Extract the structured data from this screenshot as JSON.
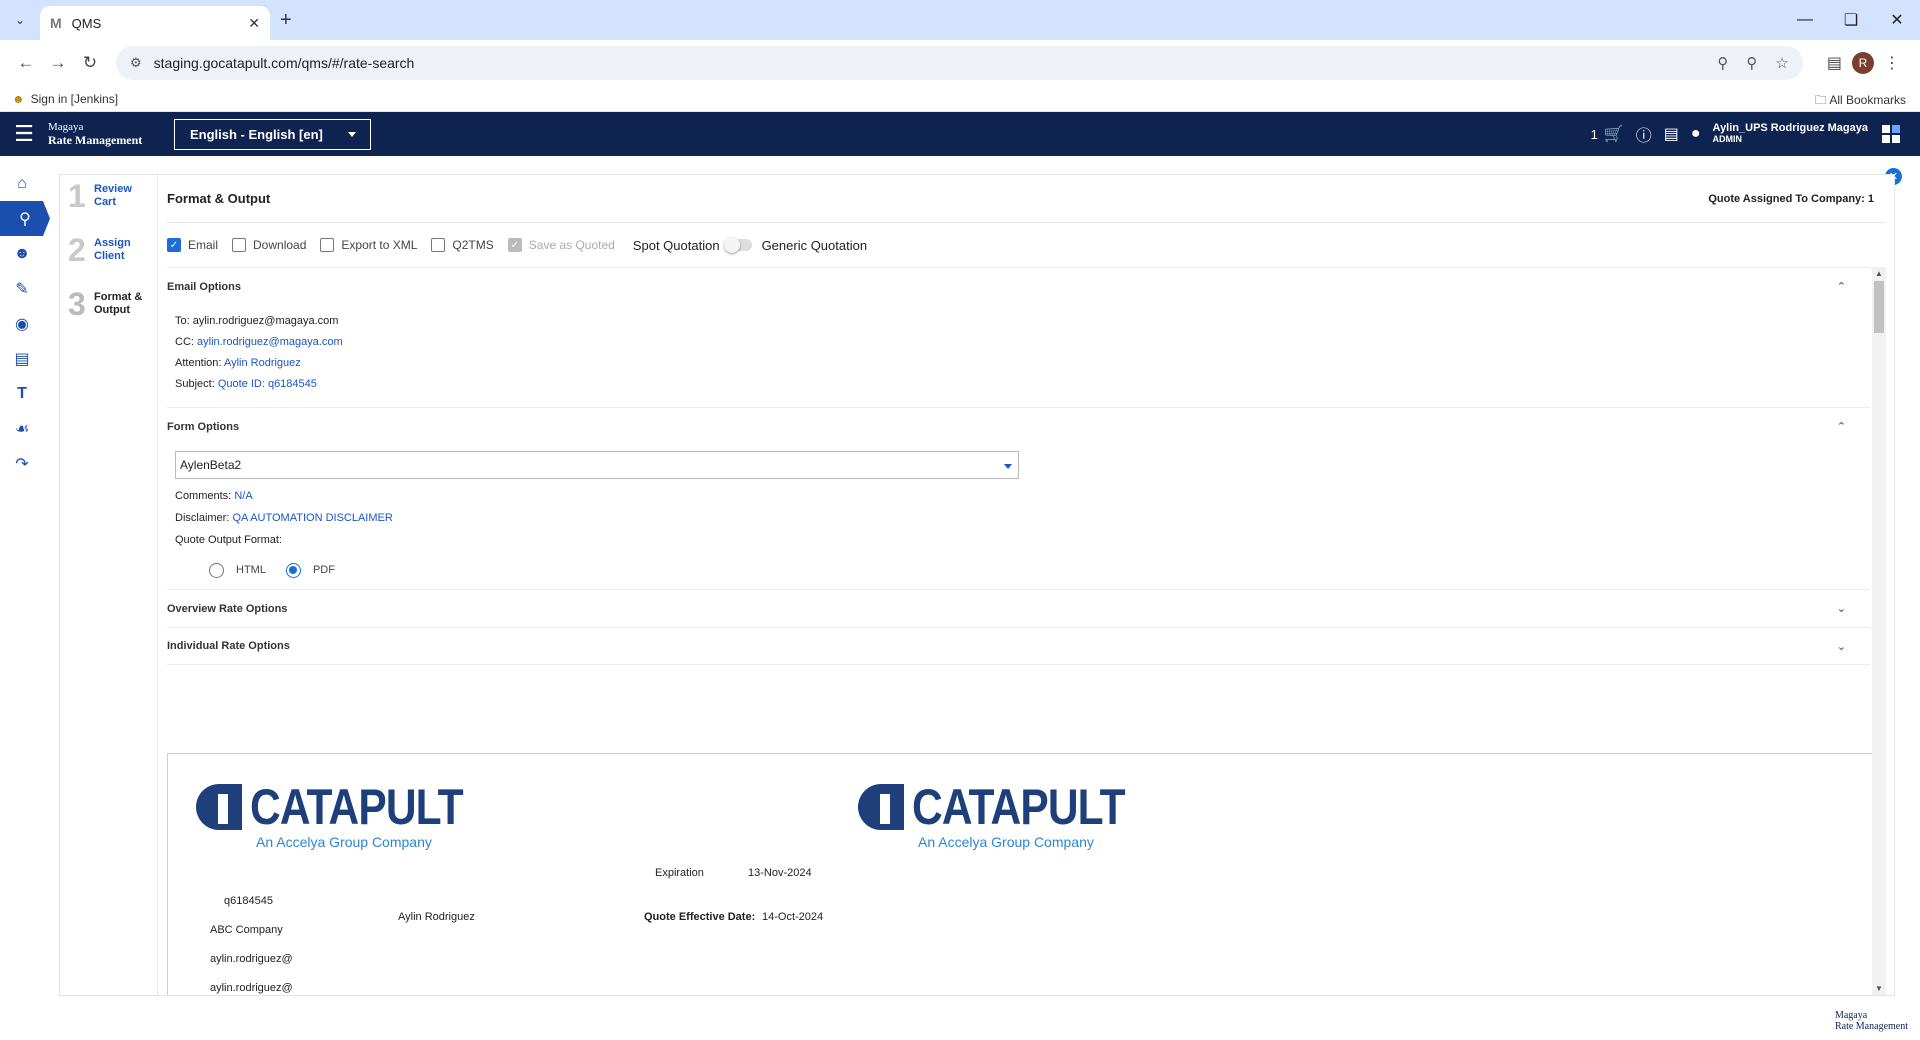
{
  "browser": {
    "tab_title": "QMS",
    "tab_favicon": "M",
    "url": "staging.gocatapult.com/qms/#/rate-search",
    "bookmark": "Sign in [Jenkins]",
    "all_bookmarks": "All Bookmarks",
    "profile_initial": "R"
  },
  "header": {
    "brand_line1": "Magaya",
    "brand_line2": "Rate Management",
    "language": "English - English [en]",
    "cart_count": "1",
    "user_name": "Aylin_UPS Rodriguez Magaya",
    "user_role": "ADMIN"
  },
  "steps": [
    {
      "num": "1",
      "label_1": "Review",
      "label_2": "Cart"
    },
    {
      "num": "2",
      "label_1": "Assign",
      "label_2": "Client"
    },
    {
      "num": "3",
      "label_1": "Format &",
      "label_2": "Output"
    }
  ],
  "content": {
    "title": "Format & Output",
    "quote_assigned": "Quote Assigned To Company: 1",
    "options": {
      "email": "Email",
      "download": "Download",
      "export_xml": "Export to XML",
      "q2tms": "Q2TMS",
      "save_as_quoted": "Save as Quoted",
      "spot": "Spot Quotation",
      "generic": "Generic Quotation"
    },
    "email_options": {
      "heading": "Email Options",
      "to_label": "To:",
      "to_value": "aylin.rodriguez@magaya.com",
      "cc_label": "CC:",
      "cc_value": "aylin.rodriguez@magaya.com",
      "attention_label": "Attention:",
      "attention_value": "Aylin Rodriguez",
      "subject_label": "Subject:",
      "subject_value": "Quote ID: q6184545"
    },
    "form_options": {
      "heading": "Form Options",
      "selected_form": "AylenBeta2",
      "comments_label": "Comments:",
      "comments_value": "N/A",
      "disclaimer_label": "Disclaimer:",
      "disclaimer_value": "QA AUTOMATION DISCLAIMER",
      "output_format_label": "Quote Output Format:",
      "format_html": "HTML",
      "format_pdf": "PDF"
    },
    "overview_rate_options": "Overview Rate Options",
    "individual_rate_options": "Individual Rate Options"
  },
  "preview": {
    "logo_word": "CATAPULT",
    "logo_tag": "An Accelya Group Company",
    "quote_id": "q6184545",
    "company": "ABC Company",
    "email_1": "aylin.rodriguez@",
    "email_2": "aylin.rodriguez@",
    "contact": "Aylin Rodriguez",
    "expiration_label": "Expiration",
    "expiration_value": "13-Nov-2024",
    "effective_label": "Quote Effective Date:",
    "effective_value": "14-Oct-2024"
  },
  "footer": {
    "line1": "Magaya",
    "line2": "Rate Management"
  },
  "colors": {
    "header_bg": "#0f2350",
    "accent": "#1a6ed8",
    "link": "#1a56c4"
  }
}
